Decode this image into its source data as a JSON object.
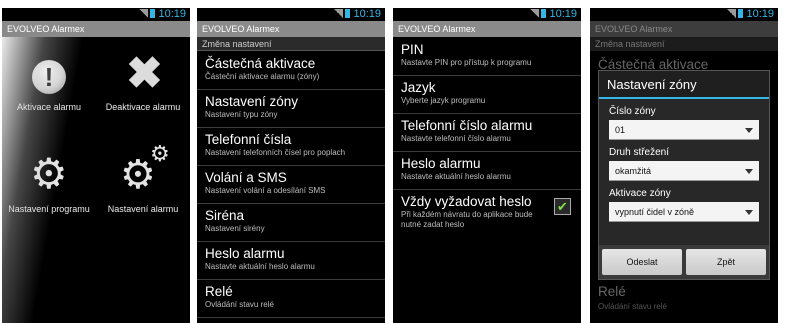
{
  "status": {
    "time": "10:19",
    "network": "3G"
  },
  "app_title": "EVOLVEO Alarmex",
  "panel1": {
    "items": [
      {
        "label": "Aktivace alarmu",
        "icon": "exclamation-icon"
      },
      {
        "label": "Deaktivace alarmu",
        "icon": "cross-icon"
      },
      {
        "label": "Nastavení programu",
        "icon": "gear-icon"
      },
      {
        "label": "Nastavení alarmu",
        "icon": "gears-icon"
      }
    ]
  },
  "panel2": {
    "subtitle": "Změna nastavení",
    "items": [
      {
        "title": "Částečná aktivace",
        "sub": "Částeční aktivace alarmu (zóny)"
      },
      {
        "title": "Nastavení zóny",
        "sub": "Nastavení typu zóny"
      },
      {
        "title": "Telefonní čísla",
        "sub": "Nastavení telefonních čísel pro poplach"
      },
      {
        "title": "Volání a SMS",
        "sub": "Nastavení volání a odesílání SMS"
      },
      {
        "title": "Siréna",
        "sub": "Nastavení sirény"
      },
      {
        "title": "Heslo alarmu",
        "sub": "Nastavte aktuální heslo alarmu"
      },
      {
        "title": "Relé",
        "sub": "Ovládání stavu relé"
      }
    ]
  },
  "panel3": {
    "items": [
      {
        "title": "PIN",
        "sub": "Nastavte PIN pro přístup k programu"
      },
      {
        "title": "Jazyk",
        "sub": "Vyberte jazyk programu"
      },
      {
        "title": "Telefonní číslo alarmu",
        "sub": "Nastavte telefonní číslo alarmu"
      },
      {
        "title": "Heslo alarmu",
        "sub": "Nastavte aktuální heslo alarmu"
      },
      {
        "title": "Vždy vyžadovat heslo",
        "sub": "Při každém návratu do aplikace bude nutné zadat heslo",
        "checked": true
      }
    ]
  },
  "panel4": {
    "bg_subtitle": "Změna nastavení",
    "bg_item_top": "Částečná aktivace",
    "bg_item_bottom": "Relé",
    "bg_item_bottom_sub": "Ovládání stavu relé",
    "dialog": {
      "title": "Nastavení zóny",
      "fields": [
        {
          "label": "Číslo zóny",
          "value": "01"
        },
        {
          "label": "Druh střežení",
          "value": "okamžitá"
        },
        {
          "label": "Aktivace zóny",
          "value": "vypnutí čidel v zóně"
        }
      ],
      "ok_label": "Odeslat",
      "cancel_label": "Zpět"
    }
  },
  "colors": {
    "accent": "#33b5e5",
    "titlebar": "#8a8a8a",
    "check": "#7ee04a"
  }
}
